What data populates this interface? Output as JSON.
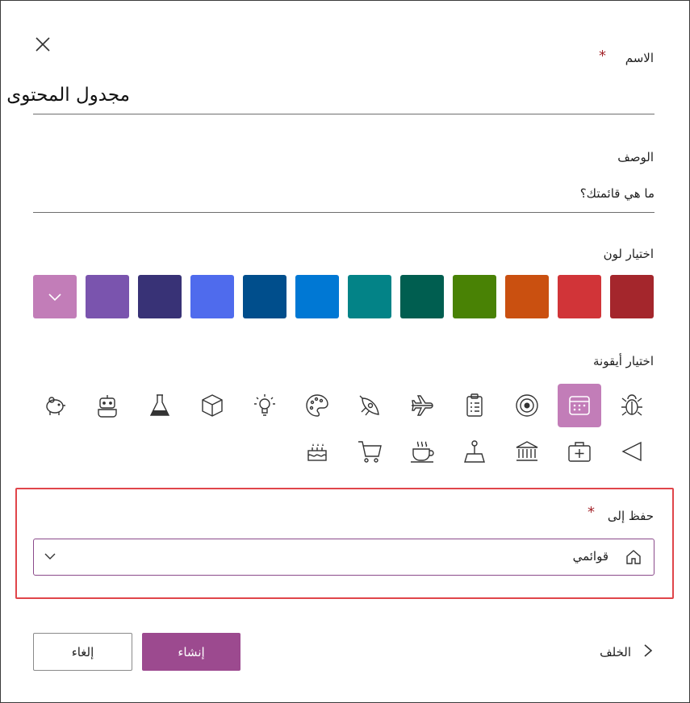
{
  "dialog": {
    "close_icon": "close-icon",
    "name": {
      "label": "الاسم",
      "required": "*",
      "value": "مجدول المحتوى"
    },
    "description": {
      "label": "الوصف",
      "placeholder": "ما هي قائمتك؟"
    },
    "color": {
      "label": "اختيار لون",
      "swatches": [
        "#c27db8",
        "#7a54ae",
        "#383276",
        "#4f6bed",
        "#004e8c",
        "#0078d4",
        "#038387",
        "#005e50",
        "#498205",
        "#ca5010",
        "#d13438",
        "#a4262c"
      ],
      "selected_index": 0
    },
    "icon": {
      "label": "اختيار أيقونة",
      "row1": [
        "piggy-bank-icon",
        "robot-icon",
        "flask-icon",
        "cube-icon",
        "lightbulb-icon",
        "palette-icon",
        "rocket-icon",
        "airplane-icon",
        "clipboard-icon",
        "target-icon",
        "calendar-icon",
        "bug-icon"
      ],
      "row2": [
        "cake-icon",
        "cart-icon",
        "coffee-icon",
        "joystick-icon",
        "bank-icon",
        "medical-kit-icon",
        "triangle-left-icon"
      ],
      "selected": "calendar-icon",
      "accent": "#c27db8"
    },
    "save_to": {
      "label": "حفظ إلى",
      "required": "*",
      "value": "قوائمي",
      "icon": "home-icon",
      "chevron": "chevron-down-icon"
    },
    "buttons": {
      "back": "الخلف",
      "create": "إنشاء",
      "cancel": "إلغاء",
      "create_color": "#9c4a8f"
    }
  }
}
